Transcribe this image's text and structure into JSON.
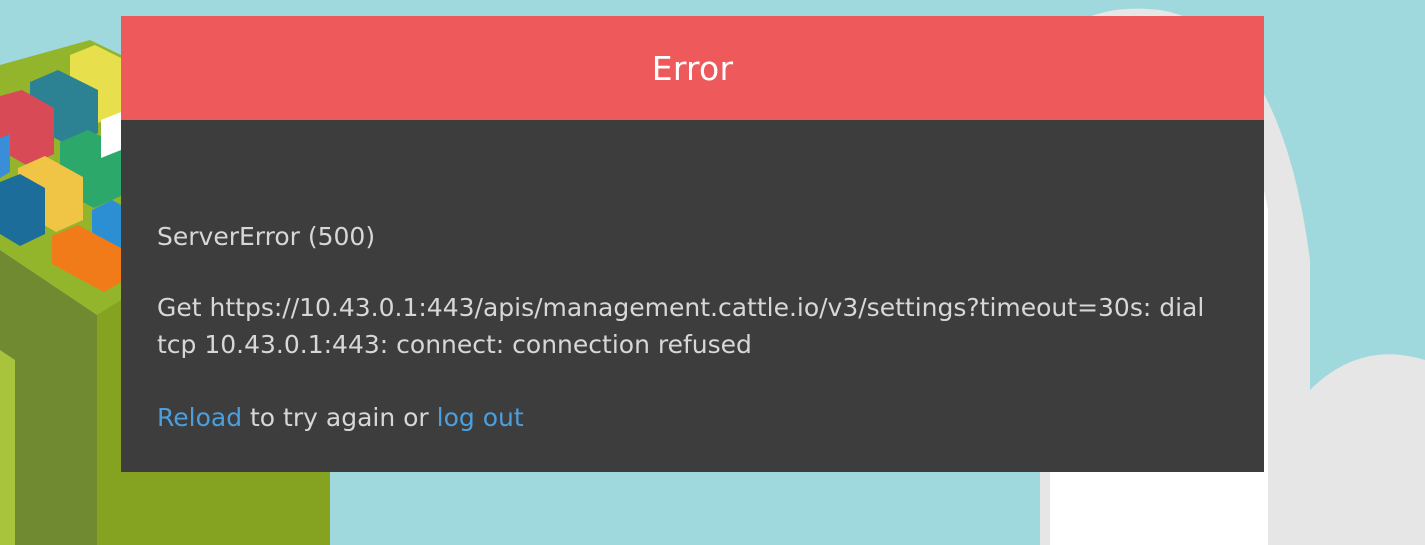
{
  "dialog": {
    "title": "Error",
    "error_summary": "ServerError (500)",
    "error_detail": "Get https://10.43.0.1:443/apis/management.cattle.io/v3/settings?timeout=30s: dial tcp 10.43.0.1:443: connect: connection refused",
    "reload_link": "Reload",
    "middle_text": " to try again or ",
    "logout_link": "log out"
  },
  "colors": {
    "background": "#9fd9de",
    "header": "#ee5a5c",
    "panel": "#3d3d3d",
    "body_text": "#d7d7d7",
    "link": "#4b9fdc"
  },
  "illustration": {
    "left": "isometric-container-yard",
    "right": "cloud"
  }
}
